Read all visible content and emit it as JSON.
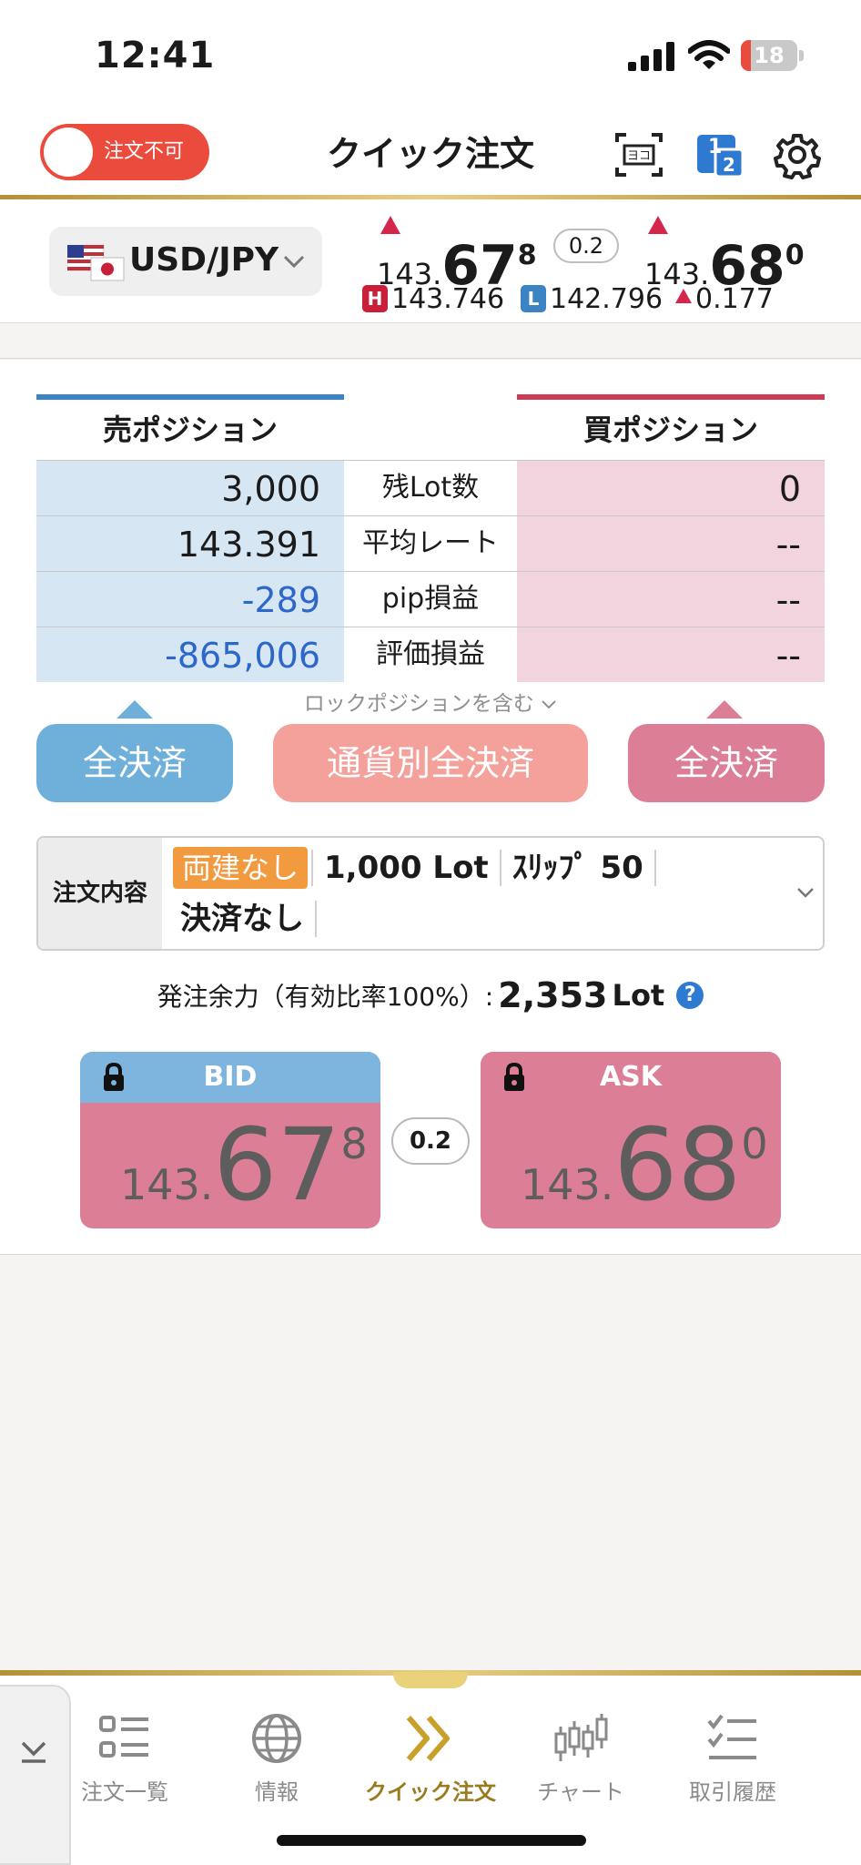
{
  "status": {
    "time": "12:41",
    "battery": "18",
    "battery_level": 0.18,
    "battery_color": "#e94b3c"
  },
  "header": {
    "toggle_label": "注文不可",
    "title": "クイック注文",
    "icons": [
      "screen-scan-icon",
      "one-two-icon",
      "gear-icon"
    ]
  },
  "rate": {
    "pair": "USD/JPY",
    "bid": {
      "prefix": "143.",
      "main": "67",
      "sup": "8"
    },
    "ask": {
      "prefix": "143.",
      "main": "68",
      "sup": "0"
    },
    "spread": "0.2",
    "high": "143.746",
    "low": "142.796",
    "change": "0.177",
    "high_badge": "H",
    "low_badge": "L"
  },
  "positions": {
    "sell_title": "売ポジション",
    "buy_title": "買ポジション",
    "rows": [
      {
        "label": "残Lot数",
        "sell": "3,000",
        "buy": "0"
      },
      {
        "label": "平均レート",
        "sell": "143.391",
        "buy": "--"
      },
      {
        "label": "pip損益",
        "sell": "-289",
        "buy": "--"
      },
      {
        "label": "評価損益",
        "sell": "-865,006",
        "buy": "--"
      }
    ],
    "lock_note": "ロックポジションを含む"
  },
  "buttons": {
    "sell_close_all": "全決済",
    "currency_close_all": "通貨別全決済",
    "buy_close_all": "全決済"
  },
  "order": {
    "label": "注文内容",
    "hedge": "両建なし",
    "lot": "1,000 Lot",
    "slip": "ｽﾘｯﾌﾟ 50",
    "settle": "決済なし"
  },
  "margin": {
    "label": "発注余力（有効比率100%）:",
    "value": "2,353",
    "unit": "Lot",
    "help": "?"
  },
  "trade": {
    "bid_label": "BID",
    "ask_label": "ASK",
    "bid": {
      "prefix": "143.",
      "main": "67",
      "sup": "8"
    },
    "ask": {
      "prefix": "143.",
      "main": "68",
      "sup": "0"
    },
    "spread": "0.2"
  },
  "tabs": [
    {
      "label": "注文一覧",
      "icon": "order-list-icon"
    },
    {
      "label": "情報",
      "icon": "globe-icon"
    },
    {
      "label": "クイック注文",
      "icon": "double-chevron-icon",
      "active": true
    },
    {
      "label": "チャート",
      "icon": "candlestick-icon"
    },
    {
      "label": "取引履歴",
      "icon": "checklist-icon"
    }
  ],
  "colors": {
    "sell_accent": "#3c83c4",
    "buy_accent": "#d03a55",
    "sell_button": "#6fb0da",
    "currency_button": "#f3a19a",
    "buy_button": "#dc7e95",
    "negative_text": "#2c67c9",
    "gold": "#b39136",
    "up_arrow": "#d4264b"
  }
}
